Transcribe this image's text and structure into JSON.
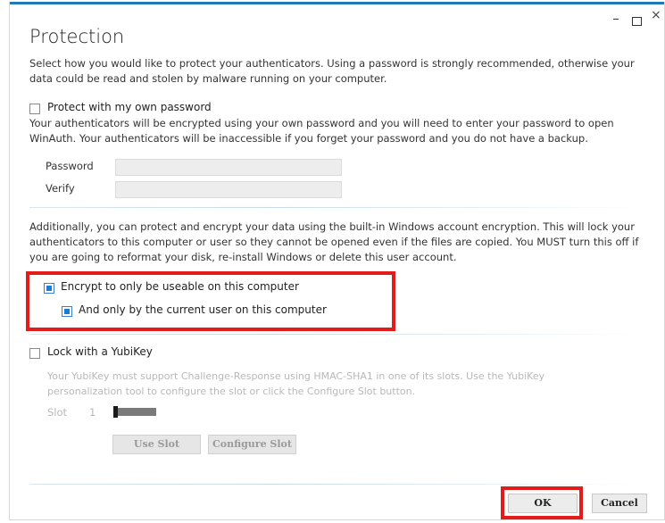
{
  "window": {
    "minimize_glyph": "_",
    "close_glyph": "×"
  },
  "dialog": {
    "title": "Protection",
    "intro": "Select how you would like to protect your authenticators. Using a password is strongly recommended, otherwise your data could be read and stolen by malware running on your computer."
  },
  "password_section": {
    "checkbox_label": "Protect with my own password",
    "checked": false,
    "description": "Your authenticators will be encrypted using your own password and you will need to enter your password to open WinAuth. Your authenticators will be inaccessible if you forget your password and you do not have a backup.",
    "password_label": "Password",
    "password_value": "",
    "verify_label": "Verify",
    "verify_value": ""
  },
  "windows_section": {
    "description": "Additionally, you can protect and encrypt your data using the built-in Windows account encryption. This will lock your authenticators to this computer or user so they cannot be opened even if the files are copied. You MUST turn this off if you are going to reformat your disk, re-install Windows or delete this user account.",
    "encrypt_machine_label": "Encrypt to only be useable on this computer",
    "encrypt_machine_checked": true,
    "encrypt_user_label": "And only by the current user on this computer",
    "encrypt_user_checked": true
  },
  "yubikey_section": {
    "checkbox_label": "Lock with a YubiKey",
    "checked": false,
    "description": "Your YubiKey must support Challenge-Response using HMAC-SHA1 in one of its slots. Use the YubiKey personalization tool to configure the slot or click the Configure Slot button.",
    "slot_label": "Slot",
    "slot_value": "1",
    "use_slot_label": "Use Slot",
    "configure_slot_label": "Configure Slot"
  },
  "footer": {
    "ok_label": "OK",
    "cancel_label": "Cancel"
  },
  "colors": {
    "accent": "#1e7bb8",
    "highlight": "#e21b1b",
    "checkbox_fill": "#1c7dd8"
  }
}
